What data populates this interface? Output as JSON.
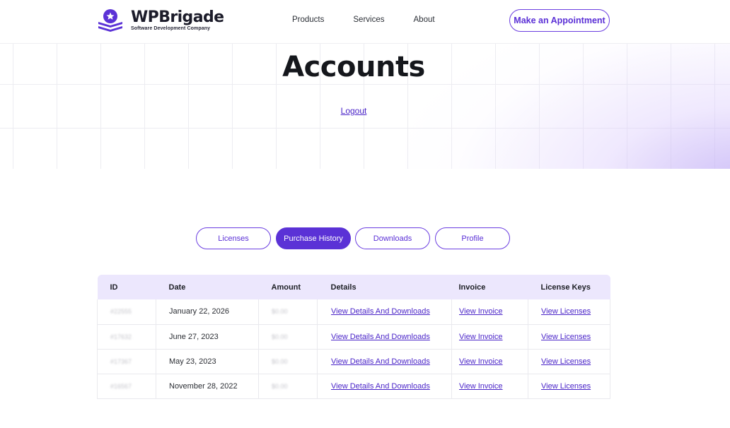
{
  "header": {
    "logo_name": "WPBrigade",
    "logo_tagline": "Software Development Company",
    "nav": [
      "Products",
      "Services",
      "About"
    ],
    "cta_label": "Make an Appointment"
  },
  "hero": {
    "title": "Accounts",
    "logout_label": "Logout"
  },
  "tabs": [
    {
      "label": "Licenses",
      "active": false
    },
    {
      "label": "Purchase History",
      "active": true
    },
    {
      "label": "Downloads",
      "active": false
    },
    {
      "label": "Profile",
      "active": false
    }
  ],
  "table": {
    "columns": [
      "ID",
      "Date",
      "Amount",
      "Details",
      "Invoice",
      "License Keys"
    ],
    "rows": [
      {
        "id": "#22555",
        "date": "January 22, 2026",
        "amount": "$0.00",
        "details": "View Details And Downloads",
        "invoice": "View Invoice",
        "license": "View Licenses"
      },
      {
        "id": "#17632",
        "date": "June 27, 2023",
        "amount": "$0.00",
        "details": "View Details And Downloads",
        "invoice": "View Invoice",
        "license": "View Licenses"
      },
      {
        "id": "#17367",
        "date": "May 23, 2023",
        "amount": "$0.00",
        "details": "View Details And Downloads",
        "invoice": "View Invoice",
        "license": "View Licenses"
      },
      {
        "id": "#16567",
        "date": "November 28, 2022",
        "amount": "$0.00",
        "details": "View Details And Downloads",
        "invoice": "View Invoice",
        "license": "View Licenses"
      }
    ]
  },
  "colors": {
    "accent": "#5b32d6",
    "table_header_bg": "#ece7fd"
  }
}
